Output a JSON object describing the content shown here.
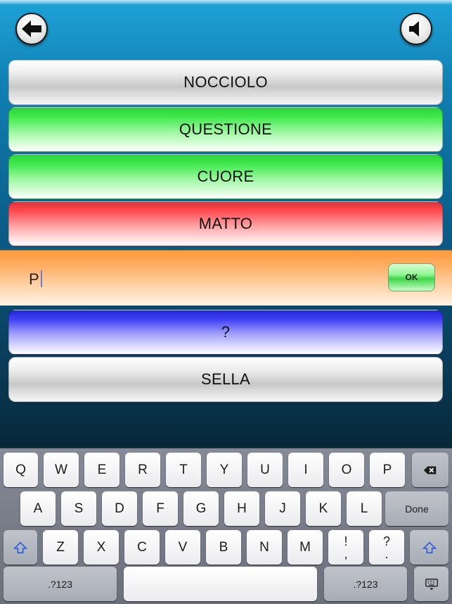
{
  "rows": [
    {
      "label": "NOCCIOLO",
      "state": "neutral"
    },
    {
      "label": "QUESTIONE",
      "state": "correct"
    },
    {
      "label": "CUORE",
      "state": "correct"
    },
    {
      "label": "MATTO",
      "state": "wrong"
    }
  ],
  "input": {
    "value": "P",
    "ok_label": "OK"
  },
  "pending_rows": [
    {
      "label": "?",
      "state": "current"
    },
    {
      "label": "SELLA",
      "state": "neutral"
    }
  ],
  "keyboard": {
    "row1": [
      "Q",
      "W",
      "E",
      "R",
      "T",
      "Y",
      "U",
      "I",
      "O",
      "P"
    ],
    "row2": [
      "A",
      "S",
      "D",
      "F",
      "G",
      "H",
      "J",
      "K",
      "L"
    ],
    "done_label": "Done",
    "row3": [
      "Z",
      "X",
      "C",
      "V",
      "B",
      "N",
      "M"
    ],
    "punct1": {
      "top": "!",
      "bottom": ","
    },
    "punct2": {
      "top": "?",
      "bottom": "."
    },
    "numbers_label": ".?123"
  },
  "icons": {
    "back": "back-arrow-icon",
    "sound": "speaker-icon",
    "backspace": "backspace-icon",
    "shift": "shift-icon",
    "hide_keyboard": "keyboard-hide-icon"
  },
  "colors": {
    "correct": "#3de84a",
    "wrong": "#ff4a50",
    "current": "#3e3ef3",
    "neutral": "#d8d8d8",
    "input_band": "#ffb068"
  }
}
